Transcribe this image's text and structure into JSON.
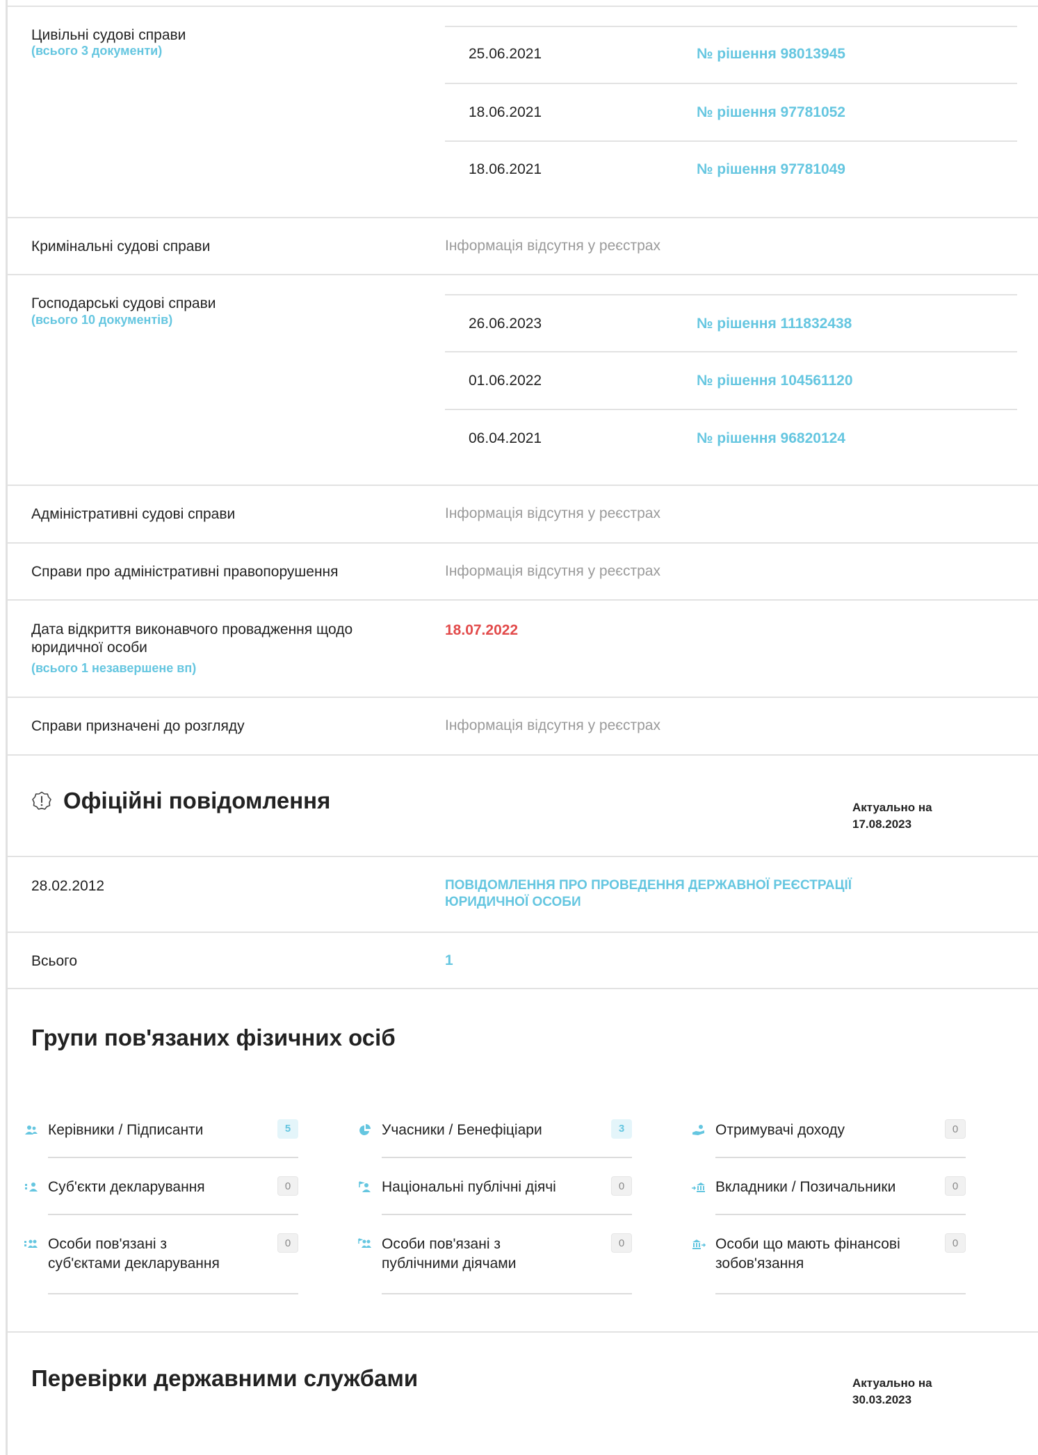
{
  "courts": {
    "civil": {
      "label": "Цивільні судові справи",
      "sub": "(всього 3 документи)",
      "rows": [
        {
          "date": "25.06.2021",
          "link": "№ рішення 98013945"
        },
        {
          "date": "18.06.2021",
          "link": "№ рішення 97781052"
        },
        {
          "date": "18.06.2021",
          "link": "№ рішення 97781049"
        }
      ]
    },
    "criminal": {
      "label": "Кримінальні судові справи",
      "value": "Інформація відсутня у реєстрах"
    },
    "commercial": {
      "label": "Господарські судові справи",
      "sub": "(всього 10 документів)",
      "rows": [
        {
          "date": "26.06.2023",
          "link": "№ рішення 111832438"
        },
        {
          "date": "01.06.2022",
          "link": "№ рішення 104561120"
        },
        {
          "date": "06.04.2021",
          "link": "№ рішення 96820124"
        }
      ]
    },
    "administrative": {
      "label": "Адміністративні судові справи",
      "value": "Інформація відсутня у реєстрах"
    },
    "offenses": {
      "label": "Справи про адміністративні правопорушення",
      "value": "Інформація відсутня у реєстрах"
    },
    "enforcement": {
      "label_line1": "Дата відкриття виконавчого провадження щодо",
      "label_line2": "юридичної особи",
      "sub": "(всього 1 незавершене вп)",
      "value": "18.07.2022"
    },
    "scheduled": {
      "label": "Справи призначені до розгляду",
      "value": "Інформація відсутня у реєстрах"
    }
  },
  "notices": {
    "title": "Офіційні повідомлення",
    "actual_label": "Актуально на",
    "actual_date": "17.08.2023",
    "row": {
      "date": "28.02.2012",
      "text_line1": "ПОВІДОМЛЕННЯ ПРО ПРОВЕДЕННЯ ДЕРЖАВНОЇ РЕЄСТРАЦІЇ",
      "text_line2": "ЮРИДИЧНОЇ ОСОБИ"
    },
    "total_label": "Всього",
    "total_value": "1"
  },
  "groups": {
    "title": "Групи пов'язаних фізичних осіб",
    "items": [
      {
        "line1": "Керівники / Підписанти",
        "line2": "",
        "count": "5"
      },
      {
        "line1": "Учасники / Бенефіціари",
        "line2": "",
        "count": "3"
      },
      {
        "line1": "Отримувачі доходу",
        "line2": "",
        "count": "0"
      },
      {
        "line1": "Суб'єкти декларування",
        "line2": "",
        "count": "0"
      },
      {
        "line1": "Національні публічні діячі",
        "line2": "",
        "count": "0"
      },
      {
        "line1": "Вкладники / Позичальники",
        "line2": "",
        "count": "0"
      },
      {
        "line1": "Особи пов'язані з",
        "line2": "суб'єктами декларування",
        "count": "0"
      },
      {
        "line1": "Особи пов'язані з",
        "line2": "публічними діячами",
        "count": "0"
      },
      {
        "line1": "Особи що мають фінансові",
        "line2": "зобов'язання",
        "count": "0"
      }
    ]
  },
  "inspections": {
    "title": "Перевірки державними службами",
    "actual_label": "Актуально на",
    "actual_date": "30.03.2023"
  },
  "colors": {
    "accent": "#65c6e0",
    "alert": "#e24a4a",
    "muted": "#9a9a9a"
  }
}
